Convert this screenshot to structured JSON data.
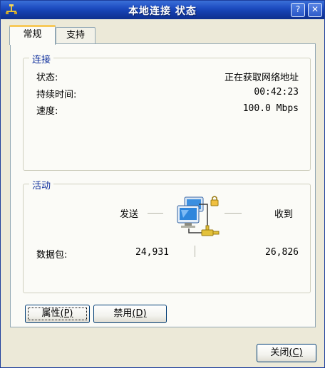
{
  "window": {
    "title": "本地连接 状态",
    "help_glyph": "?",
    "close_glyph": "✕"
  },
  "tabs": [
    {
      "label": "常规",
      "selected": true
    },
    {
      "label": "支持",
      "selected": false
    }
  ],
  "connection": {
    "legend": "连接",
    "status_label": "状态:",
    "status_value": "正在获取网络地址",
    "duration_label": "持续时间:",
    "duration_value": "00:42:23",
    "speed_label": "速度:",
    "speed_value": "100.0 Mbps"
  },
  "activity": {
    "legend": "活动",
    "sent_label": "发送",
    "received_label": "收到",
    "packets_label": "数据包:",
    "packets_sent": "24,931",
    "packets_received": "26,826",
    "icon": "network-computers-icon"
  },
  "buttons": {
    "properties_text": "属性",
    "properties_key": "(P)",
    "disable_text": "禁用",
    "disable_key": "(D)",
    "close_text": "关闭",
    "close_key": "(C)"
  },
  "colors": {
    "titlebar": "#1d4cc0",
    "dialog_bg": "#ece9d8",
    "group_legend": "#0f2f9c",
    "tab_highlight": "#f7c95a"
  }
}
